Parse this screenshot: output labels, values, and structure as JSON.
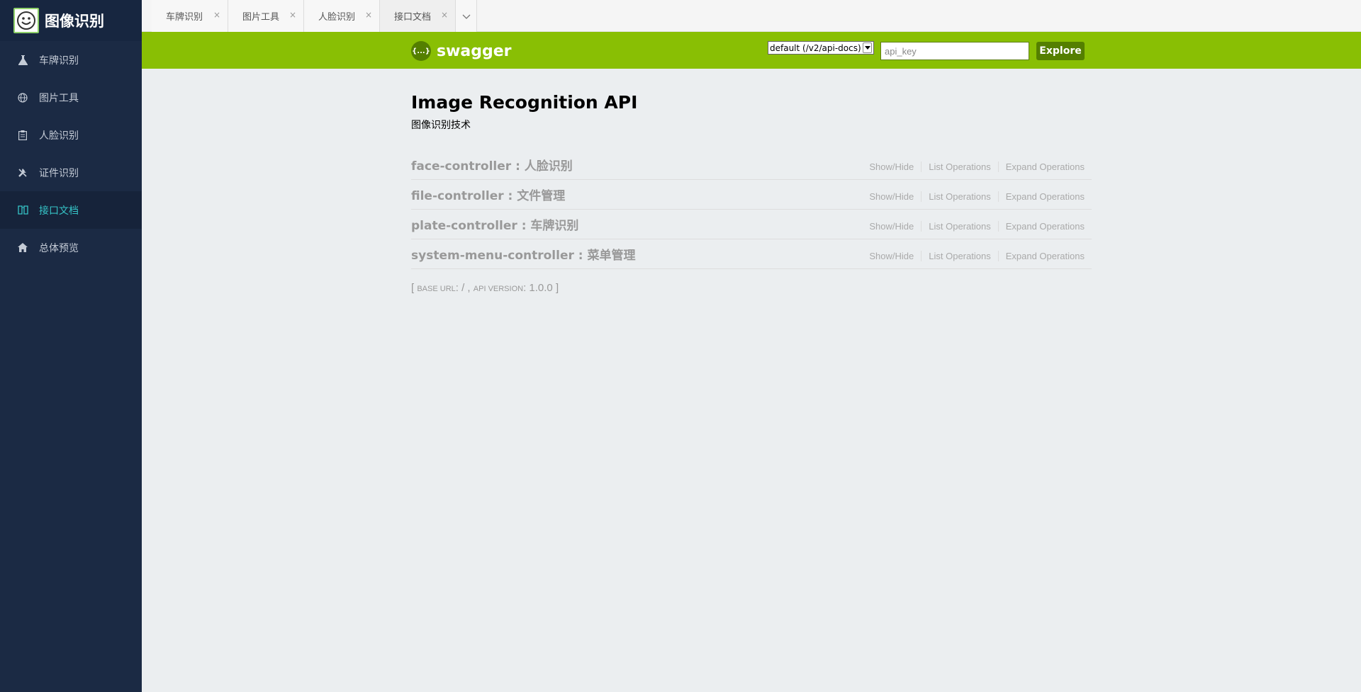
{
  "app": {
    "title": "图像识别"
  },
  "sidebar": {
    "items": [
      {
        "label": "车牌识别",
        "icon": "flask-icon",
        "active": false
      },
      {
        "label": "图片工具",
        "icon": "globe-icon",
        "active": false
      },
      {
        "label": "人脸识别",
        "icon": "clipboard-icon",
        "active": false
      },
      {
        "label": "证件识别",
        "icon": "tools-icon",
        "active": false
      },
      {
        "label": "接口文档",
        "icon": "book-icon",
        "active": true
      },
      {
        "label": "总体预览",
        "icon": "home-icon",
        "active": false
      }
    ]
  },
  "tabs": [
    {
      "label": "车牌识别",
      "close": "×"
    },
    {
      "label": "图片工具",
      "close": "×"
    },
    {
      "label": "人脸识别",
      "close": "×"
    },
    {
      "label": "接口文档",
      "close": "×"
    }
  ],
  "swagger": {
    "logo_text": "swagger",
    "logo_glyph": "{...}",
    "spec_select": "default (/v2/api-docs)",
    "api_key_placeholder": "api_key",
    "explore_label": "Explore"
  },
  "api": {
    "title": "Image Recognition API",
    "description": "图像识别技术",
    "resources": [
      {
        "name": "face-controller : 人脸识别",
        "show_hide": "Show/Hide",
        "list_ops": "List Operations",
        "expand_ops": "Expand Operations"
      },
      {
        "name": "file-controller : 文件管理",
        "show_hide": "Show/Hide",
        "list_ops": "List Operations",
        "expand_ops": "Expand Operations"
      },
      {
        "name": "plate-controller : 车牌识别",
        "show_hide": "Show/Hide",
        "list_ops": "List Operations",
        "expand_ops": "Expand Operations"
      },
      {
        "name": "system-menu-controller : 菜单管理",
        "show_hide": "Show/Hide",
        "list_ops": "List Operations",
        "expand_ops": "Expand Operations"
      }
    ],
    "footer": {
      "open": "[ ",
      "base_url_label": "base url",
      "base_url_value": ": / , ",
      "api_version_label": "api version",
      "api_version_value": ": 1.0.0 ]"
    }
  },
  "colors": {
    "sidebar_bg": "#1b2a44",
    "active_text": "#36c5c8",
    "swagger_green": "#89bf04",
    "explore_btn": "#547f00",
    "content_bg": "#ebeef0"
  }
}
